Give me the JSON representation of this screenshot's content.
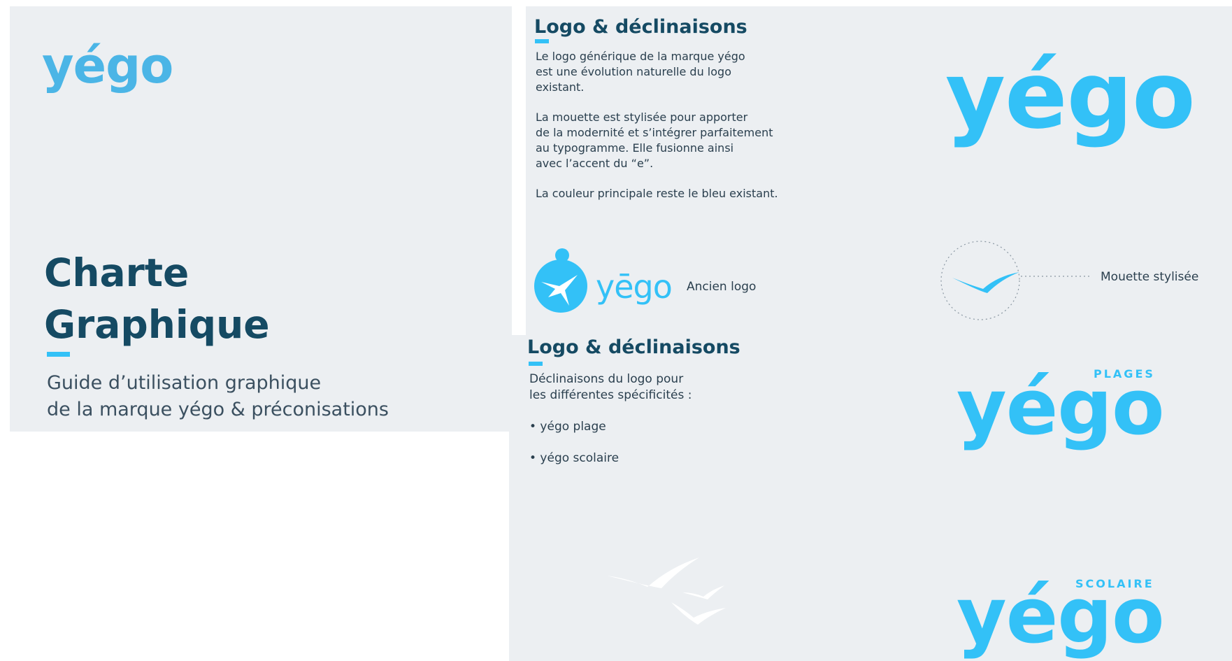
{
  "cover": {
    "logo": "yégo",
    "title_line1": "Charte",
    "title_line2": "Graphique",
    "subtitle_line1": "Guide d’utilisation graphique",
    "subtitle_line2": "de la marque yégo & préconisations"
  },
  "logo_section": {
    "heading": "Logo & déclinaisons",
    "paragraph1": "Le logo générique de la marque yégo\nest une évolution naturelle du logo\nexistant.",
    "paragraph2": "La mouette est stylisée pour apporter\nde la modernité et s’intégrer parfaitement\nau typogramme. Elle fusionne ainsi\navec l’accent du “e”.",
    "paragraph3": "La couleur principale reste le bleu existant.",
    "main_logo": "yégo",
    "old_logo_word": "yēgo",
    "old_logo_caption": "Ancien logo",
    "gull_caption": "Mouette stylisée"
  },
  "variants_section": {
    "heading": "Logo & déclinaisons",
    "intro": "Déclinaisons du logo pour\nles différentes spécificités :",
    "items": [
      "• yégo plage",
      "• yégo scolaire"
    ],
    "variant1_tag": "PLAGES",
    "variant1_logo": "yégo",
    "variant2_tag": "SCOLAIRE",
    "variant2_logo": "yégo"
  },
  "colors": {
    "brand_blue": "#33c1f7",
    "title_navy": "#154a63",
    "panel_gray": "#eceff2"
  }
}
